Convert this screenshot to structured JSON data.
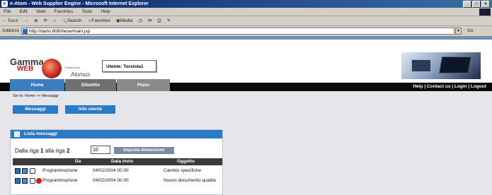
{
  "window": {
    "title": "e-Atom - Web Supplier Engine - Microsoft Internet Explorer",
    "btn_min": "_",
    "btn_max": "□",
    "btn_close": "×",
    "ie_icon": "e"
  },
  "menu": [
    "File",
    "Edit",
    "View",
    "Favorites",
    "Tools",
    "Help"
  ],
  "toolbar": {
    "back": "← Back",
    "forward": "→",
    "search": "Search",
    "favorites": "Favorites",
    "media": "Media"
  },
  "address": {
    "label": "Address",
    "url": "http://dario:8080/wse/main.jsp",
    "go": "Go"
  },
  "header": {
    "logo_gamma": "Gamma",
    "logo_web": "WEB",
    "powered_by": "Powered by",
    "atomus": "Atomus",
    "user": "Utente: Torsiola1"
  },
  "nav": {
    "tabs": [
      "Home",
      "Dibattito",
      "Piano"
    ],
    "links": "Help | Contact us | Login | Logout"
  },
  "breadcrumb": "Sei in: Home >> Messaggi",
  "subnav": {
    "messages": "Messaggi",
    "user_info": "Info utente"
  },
  "panel": {
    "title": "Lista messaggi",
    "row_prefix": "Dalla riga",
    "row_from": "1",
    "row_mid": "alla riga",
    "row_to": "2",
    "size_value": "10",
    "size_button": "Imposta dimensione",
    "columns": [
      "Da",
      "Data invio",
      "Oggetto"
    ],
    "rows": [
      {
        "from": "Programmazione",
        "date": "04/02/2004 00.00",
        "subject": "Cambio specifiche"
      },
      {
        "from": "Programmazione",
        "date": "04/02/2004 00.00",
        "subject": "Nuovo documento qualità"
      }
    ]
  },
  "colors": {
    "accent": "#2a7ac4",
    "nav_bg": "#0a0a0a",
    "page_bg": "#e6e6ea"
  }
}
